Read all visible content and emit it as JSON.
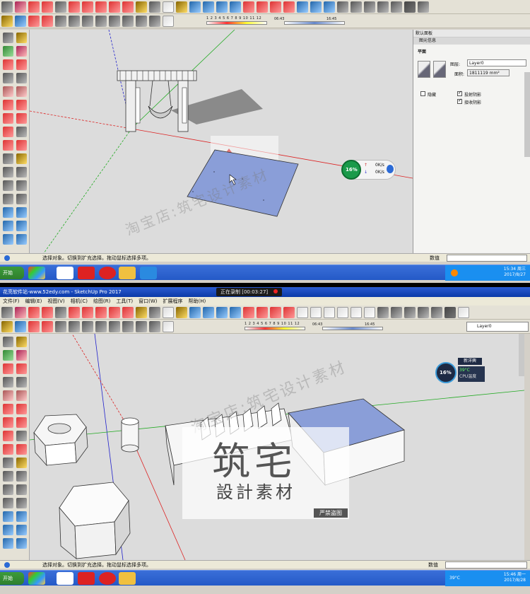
{
  "top": {
    "tray": {
      "header": "默认面板",
      "section": "图元信息",
      "entity_type": "平面",
      "layer_label": "图层:",
      "layer_value": "Layer0",
      "area_label": "面积:",
      "area_value": "1811119 mm²",
      "hide_label": "隐藏",
      "cast_shadow_label": "投射阴影",
      "receive_shadow_label": "接收阴影"
    },
    "status_hint": "选择对象。切换到扩充选择。拖动鼠标选择多项。",
    "vcb_label": "数值",
    "shadow_time_start": "06:43",
    "shadow_time_end": "16:45",
    "months": "1 2 3 4 5 6 7 8 9 10 11 12",
    "gauge_percent": "16%",
    "gauge_up": "0K/s",
    "gauge_down": "0K/s",
    "watermark": "淘宝店:筑宅设计素材",
    "taskbar_start": "开始",
    "clock_time": "15:34 周三",
    "clock_date": "2017/8/27"
  },
  "bottom": {
    "title": "花亮软件站-www.52edy.com - SketchUp Pro 2017",
    "recorder": "正在录制 [00:03:27]",
    "menu": [
      "文件(F)",
      "编辑(E)",
      "视图(V)",
      "相机(C)",
      "绘图(R)",
      "工具(T)",
      "窗口(W)",
      "扩展程序",
      "帮助(H)"
    ],
    "layer_value": "Layer0",
    "shadow_time_start": "06:43",
    "shadow_time_end": "16:45",
    "months": "1 2 3 4 5 6 7 8 9 10 11 12",
    "gauge_percent": "16%",
    "temp_badge": "新洋興",
    "cpu_temp": "39°C",
    "cpu_label": "CPU温度",
    "watermark": "淘宝店:筑宅设计素材",
    "stamp_big": "筑宅",
    "stamp_mid": "設計素材",
    "stamp_small": "严禁盗图",
    "status_hint": "选择对象。切换到扩充选择。拖动鼠标选择多项。",
    "vcb_label": "数值",
    "taskbar_start": "开始",
    "clock_time": "15:46 周一",
    "clock_date": "2017/8/28",
    "cpu_tray": "39°C"
  },
  "colors": {
    "viewport": "#dcdcdc",
    "axis_red": "#d22",
    "axis_green": "#2a2",
    "axis_blue": "#22c",
    "selection": "#8a9ed8",
    "gauge_green": "#1a9a4a"
  }
}
